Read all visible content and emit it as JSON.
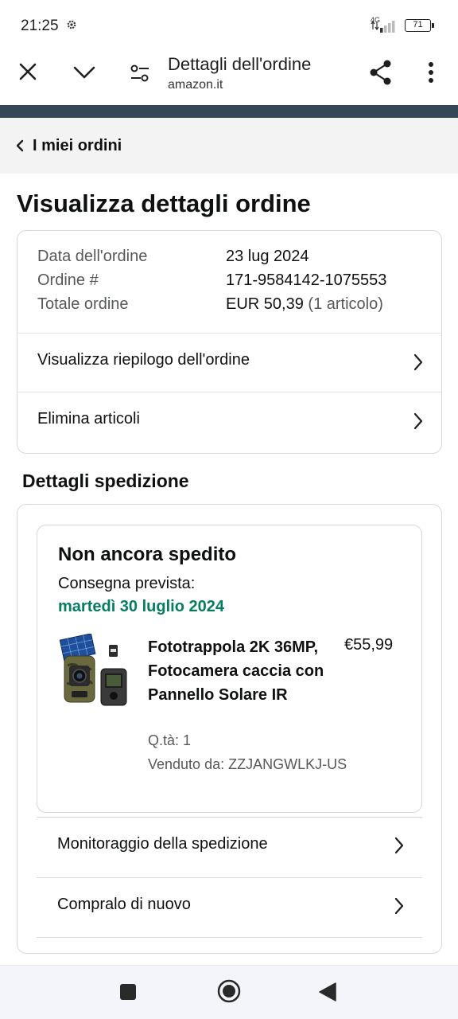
{
  "status_bar": {
    "time": "21:25",
    "network": "4G",
    "battery": "71"
  },
  "browser": {
    "title": "Dettagli dell'ordine",
    "url": "amazon.it",
    "icons": [
      "close-icon",
      "chevron-down-icon",
      "tune-icon",
      "share-icon",
      "more-vertical-icon"
    ]
  },
  "breadcrumb": {
    "label": "I miei ordini"
  },
  "page": {
    "title": "Visualizza dettagli ordine"
  },
  "order_summary": {
    "rows": [
      {
        "label": "Data dell'ordine",
        "value": "23 lug 2024"
      },
      {
        "label": "Ordine #",
        "value": "171-9584142-1075553"
      },
      {
        "label": "Totale ordine",
        "value": "EUR 50,39",
        "extra": "(1 articolo)"
      }
    ],
    "links": [
      {
        "label": "Visualizza riepilogo dell'ordine"
      },
      {
        "label": "Elimina articoli"
      }
    ]
  },
  "shipment": {
    "section_title": "Dettagli spedizione",
    "status": "Non ancora spedito",
    "delivery_label": "Consegna prevista:",
    "delivery_date": "martedì 30 luglio 2024",
    "product": {
      "title": "Fototrappola 2K 36MP, Fotocamera caccia con Pannello Solare IR",
      "price": "€55,99",
      "qty": "Q.tà: 1",
      "seller": "Venduto da: ZZJANGWLKJ-US"
    },
    "links": [
      {
        "label": "Monitoraggio della spedizione"
      },
      {
        "label": "Compralo di nuovo"
      }
    ]
  },
  "colors": {
    "accent_green": "#067d62",
    "header_strip": "#37475a",
    "text": "#0f1111",
    "muted": "#565959"
  }
}
